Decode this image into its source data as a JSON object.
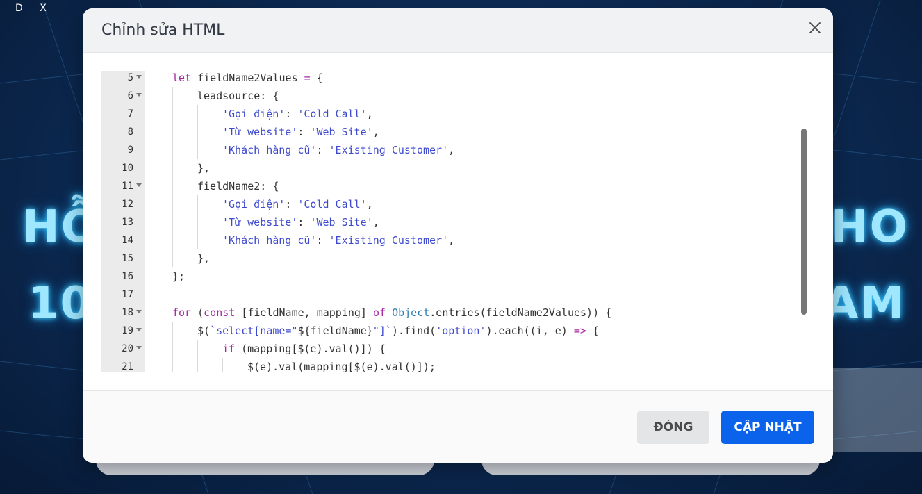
{
  "background": {
    "corner_label": "D X",
    "left_line1": "HỖ",
    "left_line2": "10",
    "right_line1": "HO",
    "right_line2": "AM"
  },
  "modal": {
    "title": "Chỉnh sửa HTML",
    "close_icon": "close-icon",
    "buttons": {
      "close_label": "ĐÓNG",
      "update_label": "CẬP NHẬT"
    }
  },
  "colors": {
    "primary": "#0a63ea",
    "keyword": "#a626a4",
    "string": "#3f4bcf"
  },
  "editor": {
    "lines": [
      {
        "n": "5",
        "fold": true,
        "indent": 1,
        "tokens": [
          [
            "kw",
            "let "
          ],
          [
            "pl",
            "fieldName2Values "
          ],
          [
            "kw",
            "="
          ],
          [
            "pl",
            " {"
          ]
        ]
      },
      {
        "n": "6",
        "fold": true,
        "indent": 2,
        "tokens": [
          [
            "pl",
            "leadsource: {"
          ]
        ]
      },
      {
        "n": "7",
        "fold": false,
        "indent": 3,
        "tokens": [
          [
            "str",
            "'Gọi điện'"
          ],
          [
            "pl",
            ": "
          ],
          [
            "str",
            "'Cold Call'"
          ],
          [
            "pl",
            ","
          ]
        ]
      },
      {
        "n": "8",
        "fold": false,
        "indent": 3,
        "tokens": [
          [
            "str",
            "'Từ website'"
          ],
          [
            "pl",
            ": "
          ],
          [
            "str",
            "'Web Site'"
          ],
          [
            "pl",
            ","
          ]
        ]
      },
      {
        "n": "9",
        "fold": false,
        "indent": 3,
        "tokens": [
          [
            "str",
            "'Khách hàng cũ'"
          ],
          [
            "pl",
            ": "
          ],
          [
            "str",
            "'Existing Customer'"
          ],
          [
            "pl",
            ","
          ]
        ]
      },
      {
        "n": "10",
        "fold": false,
        "indent": 2,
        "tokens": [
          [
            "pl",
            "},"
          ]
        ]
      },
      {
        "n": "11",
        "fold": true,
        "indent": 2,
        "tokens": [
          [
            "pl",
            "fieldName2: {"
          ]
        ]
      },
      {
        "n": "12",
        "fold": false,
        "indent": 3,
        "tokens": [
          [
            "str",
            "'Gọi điện'"
          ],
          [
            "pl",
            ": "
          ],
          [
            "str",
            "'Cold Call'"
          ],
          [
            "pl",
            ","
          ]
        ]
      },
      {
        "n": "13",
        "fold": false,
        "indent": 3,
        "tokens": [
          [
            "str",
            "'Từ website'"
          ],
          [
            "pl",
            ": "
          ],
          [
            "str",
            "'Web Site'"
          ],
          [
            "pl",
            ","
          ]
        ]
      },
      {
        "n": "14",
        "fold": false,
        "indent": 3,
        "tokens": [
          [
            "str",
            "'Khách hàng cũ'"
          ],
          [
            "pl",
            ": "
          ],
          [
            "str",
            "'Existing Customer'"
          ],
          [
            "pl",
            ","
          ]
        ]
      },
      {
        "n": "15",
        "fold": false,
        "indent": 2,
        "tokens": [
          [
            "pl",
            "},"
          ]
        ]
      },
      {
        "n": "16",
        "fold": false,
        "indent": 1,
        "tokens": [
          [
            "pl",
            "};"
          ]
        ]
      },
      {
        "n": "17",
        "fold": false,
        "indent": 1,
        "tokens": []
      },
      {
        "n": "18",
        "fold": true,
        "indent": 1,
        "tokens": [
          [
            "kw",
            "for"
          ],
          [
            "pl",
            " ("
          ],
          [
            "kw",
            "const"
          ],
          [
            "pl",
            " [fieldName, mapping] "
          ],
          [
            "kw",
            "of"
          ],
          [
            "pl",
            " "
          ],
          [
            "obj",
            "Object"
          ],
          [
            "pl",
            ".entries(fieldName2Values)) {"
          ]
        ]
      },
      {
        "n": "19",
        "fold": true,
        "indent": 2,
        "tokens": [
          [
            "pl",
            "$("
          ],
          [
            "str",
            "`select[name=\""
          ],
          [
            "pl",
            "${fieldName}"
          ],
          [
            "str",
            "\"]`"
          ],
          [
            "pl",
            ").find("
          ],
          [
            "str",
            "'option'"
          ],
          [
            "pl",
            ").each((i, e) "
          ],
          [
            "kw",
            "=>"
          ],
          [
            "pl",
            " {"
          ]
        ]
      },
      {
        "n": "20",
        "fold": true,
        "indent": 3,
        "tokens": [
          [
            "kw",
            "if"
          ],
          [
            "pl",
            " (mapping[$(e).val()]) {"
          ]
        ]
      },
      {
        "n": "21",
        "fold": false,
        "indent": 4,
        "tokens": [
          [
            "pl",
            "$(e).val(mapping[$(e).val()]);"
          ]
        ]
      }
    ]
  }
}
